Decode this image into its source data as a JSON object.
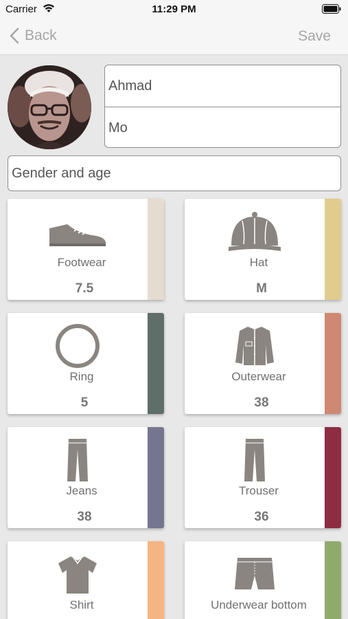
{
  "status_bar": {
    "carrier": "Carrier",
    "time": "11:29 PM"
  },
  "nav": {
    "back_label": "Back",
    "save_label": "Save"
  },
  "profile": {
    "first_name": "Ahmad",
    "last_name": "Mo",
    "gender_age_label": "Gender and age"
  },
  "categories": [
    {
      "label": "Footwear",
      "value": "7.5",
      "color": "#e5dcd0",
      "icon": "shoe-icon"
    },
    {
      "label": "Hat",
      "value": "M",
      "color": "#e2cb8e",
      "icon": "cap-icon"
    },
    {
      "label": "Ring",
      "value": "5",
      "color": "#5f6e68",
      "icon": "ring-icon"
    },
    {
      "label": "Outerwear",
      "value": "38",
      "color": "#cf8872",
      "icon": "jacket-icon"
    },
    {
      "label": "Jeans",
      "value": "38",
      "color": "#767590",
      "icon": "jeans-icon"
    },
    {
      "label": "Trouser",
      "value": "36",
      "color": "#8e2d42",
      "icon": "trouser-icon"
    },
    {
      "label": "Shirt",
      "value": "",
      "color": "#f5b482",
      "icon": "shirt-icon"
    },
    {
      "label": "Underwear bottom",
      "value": "",
      "color": "#8fab6c",
      "icon": "underwear-icon"
    }
  ]
}
